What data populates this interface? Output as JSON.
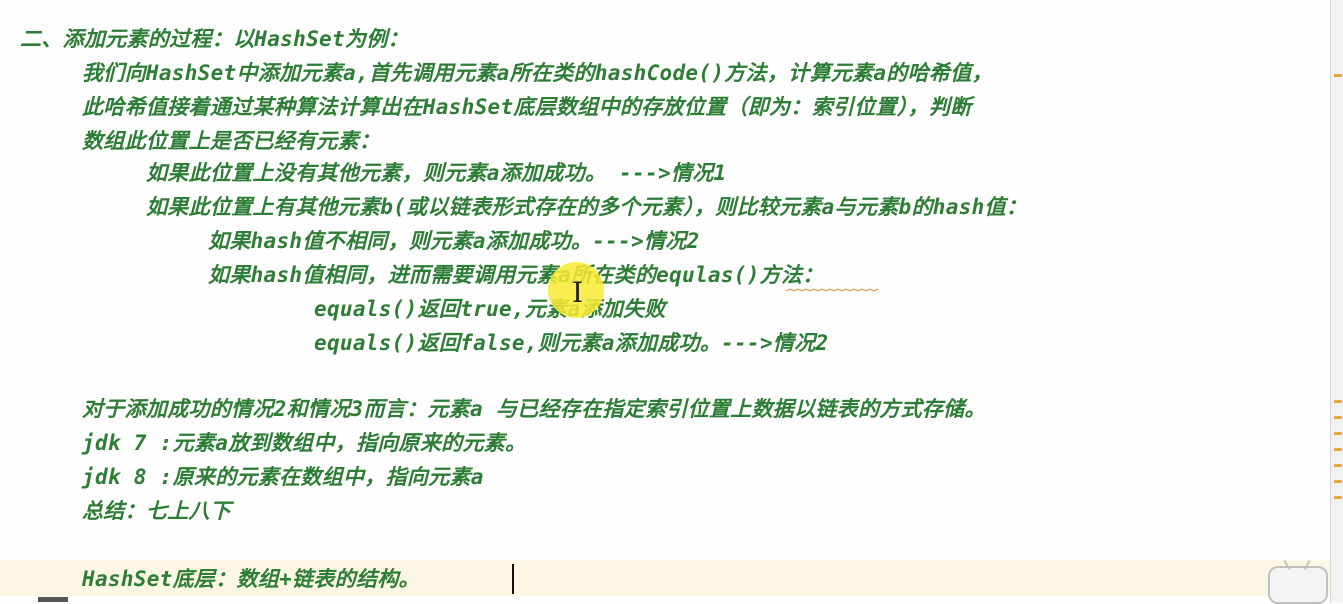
{
  "lines": [
    "二、添加元素的过程：以HashSet为例：",
    "我们向HashSet中添加元素a,首先调用元素a所在类的hashCode()方法，计算元素a的哈希值，",
    "此哈希值接着通过某种算法计算出在HashSet底层数组中的存放位置（即为：索引位置），判断",
    "数组此位置上是否已经有元素：",
    "如果此位置上没有其他元素，则元素a添加成功。 --->情况1",
    "如果此位置上有其他元素b(或以链表形式存在的多个元素），则比较元素a与元素b的hash值：",
    "如果hash值不相同，则元素a添加成功。--->情况2",
    "如果hash值相同，进而需要调用元素a所在类的equlas()方法：",
    "equals()返回true,元素a添加失败",
    "equals()返回false,则元素a添加成功。--->情况2",
    "对于添加成功的情况2和情况3而言：元素a 与已经存在指定索引位置上数据以链表的方式存储。",
    "jdk 7 :元素a放到数组中，指向原来的元素。",
    "jdk 8 :原来的元素在数组中，指向元素a",
    "总结：七上八下",
    "HashSet底层：数组+链表的结构。"
  ],
  "icons": {
    "text_cursor": "I",
    "logo": "bilibili-tv-icon"
  },
  "colors": {
    "text": "#2e7d36",
    "current_line": "#fbf7e4",
    "highlight": "#f8ea32",
    "marker": "#e8a642"
  }
}
